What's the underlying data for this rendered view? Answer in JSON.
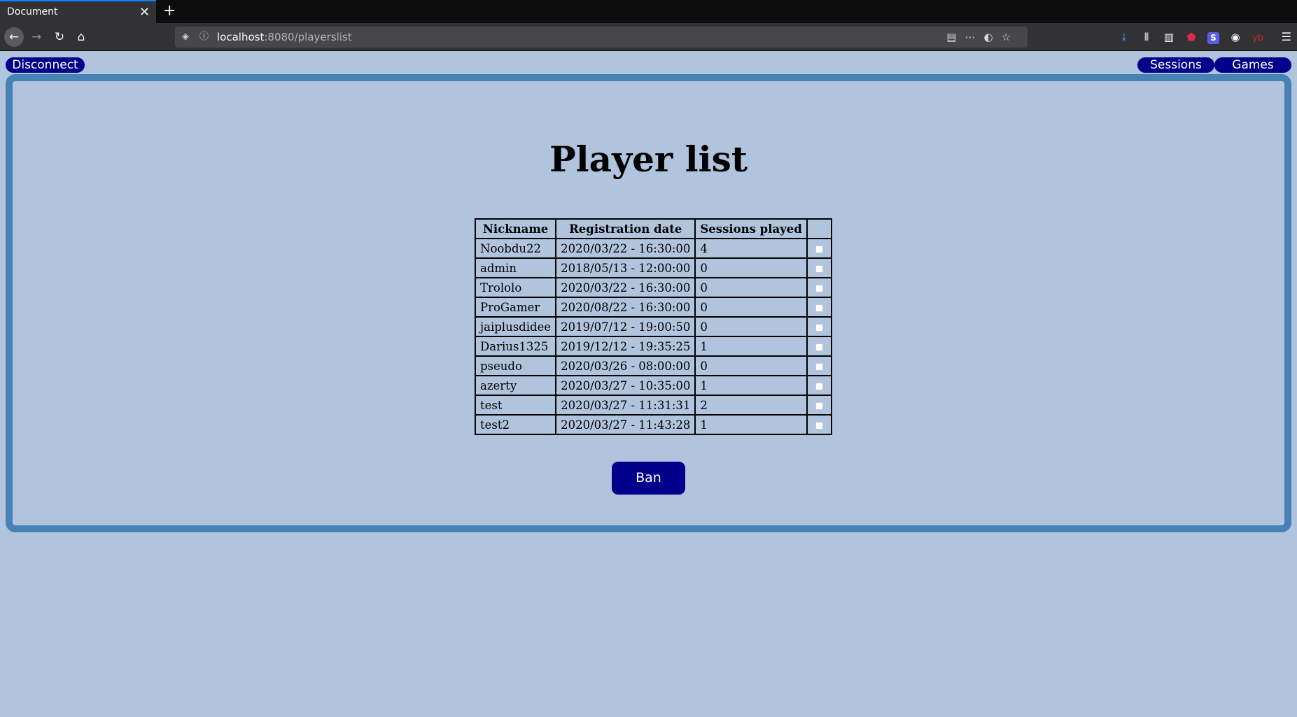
{
  "browser": {
    "tab_title": "Document",
    "tab_close": "✕",
    "new_tab": "+",
    "url_host": "localhost",
    "url_rest": ":8080/playerslist",
    "toolbar_icons": [
      "download-icon",
      "library-icon",
      "sidebar-icon",
      "ublock-icon",
      "extension-s-icon",
      "account-icon",
      "yb-icon",
      "menu-icon"
    ]
  },
  "nav": {
    "disconnect_label": "Disconnect",
    "sessions_label": "Sessions",
    "games_label": "Games"
  },
  "page": {
    "title": "Player list",
    "table": {
      "headers": [
        "Nickname",
        "Registration date",
        "Sessions played",
        ""
      ],
      "rows": [
        {
          "nickname": "Noobdu22",
          "date": "2020/03/22 - 16:30:00",
          "sessions": "4",
          "checked": false
        },
        {
          "nickname": "admin",
          "date": "2018/05/13 - 12:00:00",
          "sessions": "0",
          "checked": false
        },
        {
          "nickname": "Trololo",
          "date": "2020/03/22 - 16:30:00",
          "sessions": "0",
          "checked": false
        },
        {
          "nickname": "ProGamer",
          "date": "2020/08/22 - 16:30:00",
          "sessions": "0",
          "checked": false
        },
        {
          "nickname": "jaiplusdidee",
          "date": "2019/07/12 - 19:00:50",
          "sessions": "0",
          "checked": false
        },
        {
          "nickname": "Darius1325",
          "date": "2019/12/12 - 19:35:25",
          "sessions": "1",
          "checked": false
        },
        {
          "nickname": "pseudo",
          "date": "2020/03/26 - 08:00:00",
          "sessions": "0",
          "checked": false
        },
        {
          "nickname": "azerty",
          "date": "2020/03/27 - 10:35:00",
          "sessions": "1",
          "checked": false
        },
        {
          "nickname": "test",
          "date": "2020/03/27 - 11:31:31",
          "sessions": "2",
          "checked": false
        },
        {
          "nickname": "test2",
          "date": "2020/03/27 - 11:43:28",
          "sessions": "1",
          "checked": false
        }
      ]
    },
    "ban_label": "Ban"
  },
  "colors": {
    "background": "#b0c4de",
    "panel_border": "#4682b4",
    "button": "#00008b"
  }
}
